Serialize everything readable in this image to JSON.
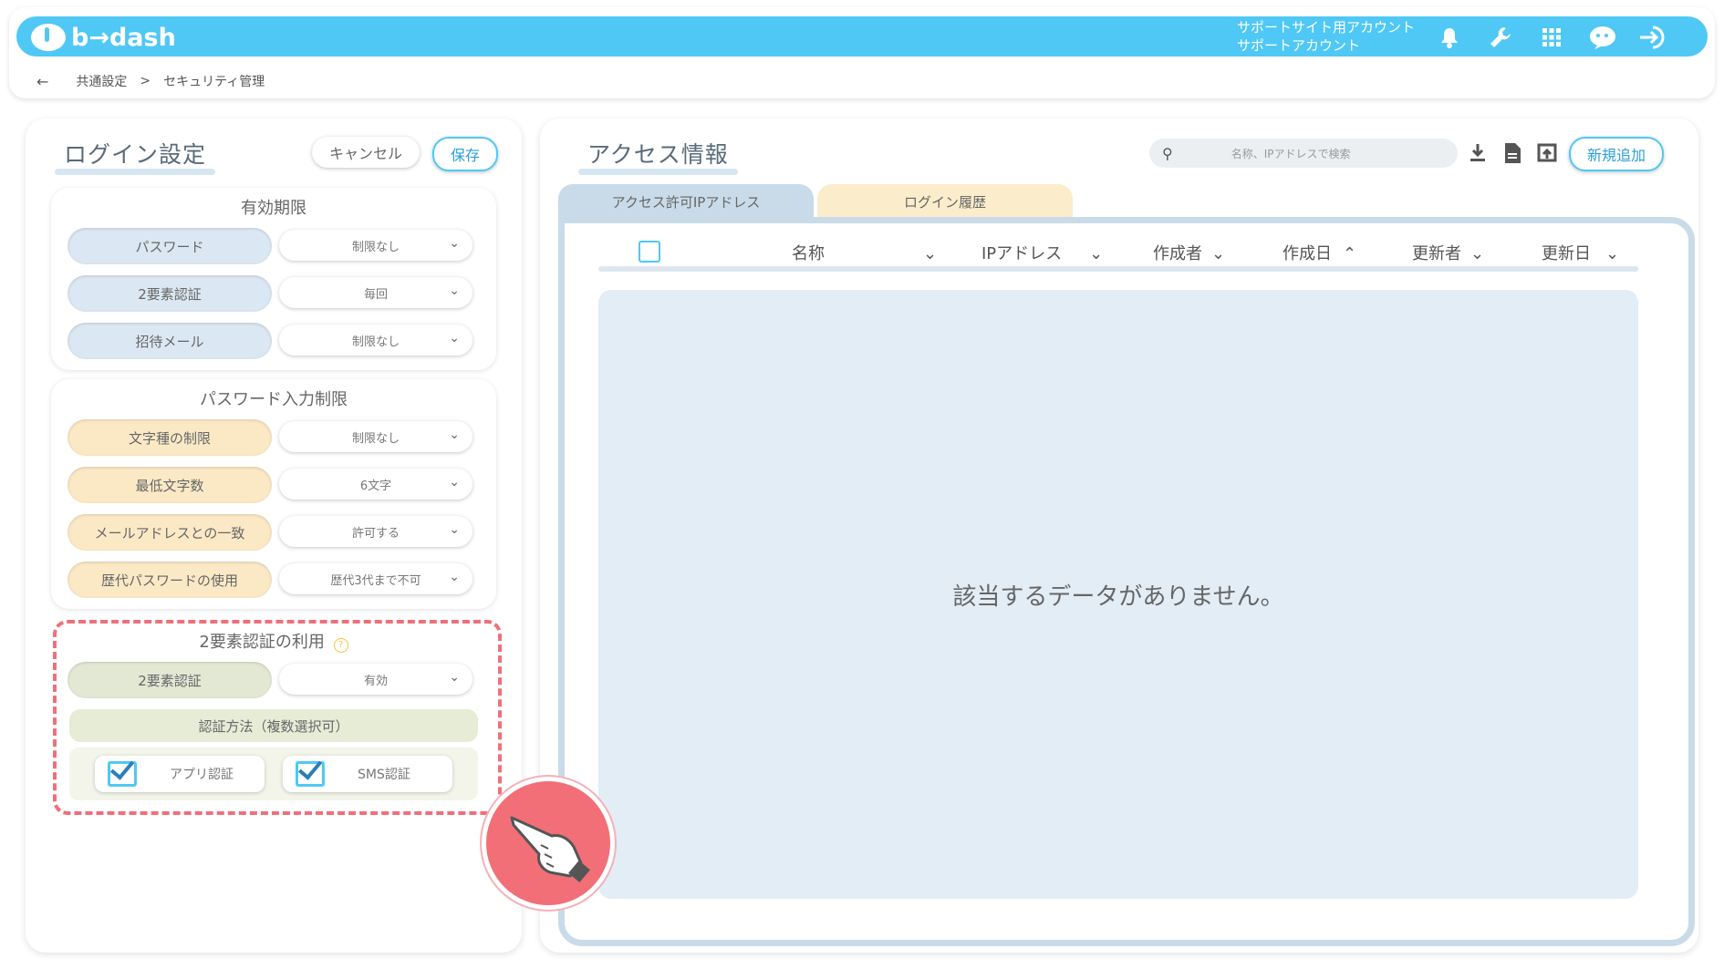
{
  "header": {
    "logo": "b→dash",
    "account_line1": "サポートサイト用アカウント",
    "account_line2": "サポートアカウント",
    "icons": [
      "bell-icon",
      "wrench-icon",
      "grid-icon",
      "chat-bot-icon",
      "logout-icon"
    ]
  },
  "breadcrumb": {
    "back": "←",
    "parent": "共通設定",
    "sep": ">",
    "current": "セキュリティ管理"
  },
  "login": {
    "title": "ログイン設定",
    "cancel_label": "キャンセル",
    "save_label": "保存",
    "expiry": {
      "title": "有効期限",
      "rows": [
        {
          "label": "パスワード",
          "value": "制限なし"
        },
        {
          "label": "2要素認証",
          "value": "毎回"
        },
        {
          "label": "招待メール",
          "value": "制限なし"
        }
      ]
    },
    "password": {
      "title": "パスワード入力制限",
      "rows": [
        {
          "label": "文字種の制限",
          "value": "制限なし"
        },
        {
          "label": "最低文字数",
          "value": "6文字"
        },
        {
          "label": "メールアドレスとの一致",
          "value": "許可する"
        },
        {
          "label": "歴代パスワードの使用",
          "value": "歴代3代まで不可"
        }
      ]
    },
    "twofactor": {
      "title": "2要素認証の利用",
      "help": "?",
      "row_label": "2要素認証",
      "row_value": "有効",
      "method_title": "認証方法（複数選択可）",
      "methods": [
        {
          "label": "アプリ認証",
          "checked": true
        },
        {
          "label": "SMS認証",
          "checked": true
        }
      ]
    }
  },
  "access": {
    "title": "アクセス情報",
    "search_placeholder": "名称、IPアドレスで検索",
    "new_label": "新規追加",
    "tabs": [
      "アクセス許可IPアドレス",
      "ログイン履歴"
    ],
    "columns": [
      "名称",
      "IPアドレス",
      "作成者",
      "作成日",
      "更新者",
      "更新日"
    ],
    "empty_message": "該当するデータがありません。"
  },
  "colors": {
    "accent": "#4fc8f5",
    "highlight": "#f06f79"
  }
}
